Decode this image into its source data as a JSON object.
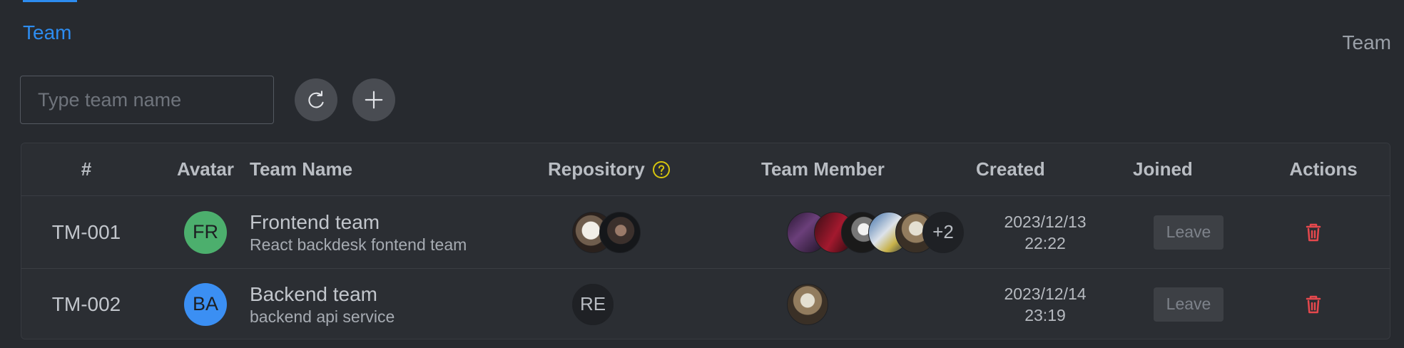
{
  "colors": {
    "accent": "#2d8cf0",
    "danger": "#e5484d",
    "help": "#d7c60d"
  },
  "breadcrumb": {
    "label": "Team"
  },
  "header": {
    "title": "Team"
  },
  "toolbar": {
    "search_placeholder": "Type team name",
    "refresh_icon": "refresh-icon",
    "add_icon": "plus-icon"
  },
  "table": {
    "columns": {
      "num": "#",
      "avatar": "Avatar",
      "team_name": "Team Name",
      "repository": "Repository",
      "team_member": "Team Member",
      "created": "Created",
      "joined": "Joined",
      "actions": "Actions"
    },
    "rows": [
      {
        "id": "TM-001",
        "avatar_text": "FR",
        "avatar_color": "#4caf6d",
        "name": "Frontend team",
        "description": "React backdesk fontend team",
        "repository_overflow": "",
        "member_overflow": "+2",
        "created_date": "2023/12/13",
        "created_time": "22:22",
        "joined_button": "Leave"
      },
      {
        "id": "TM-002",
        "avatar_text": "BA",
        "avatar_color": "#3b8ff3",
        "name": "Backend team",
        "description": "backend api service",
        "repository_text": "RE",
        "created_date": "2023/12/14",
        "created_time": "23:19",
        "joined_button": "Leave"
      }
    ]
  }
}
